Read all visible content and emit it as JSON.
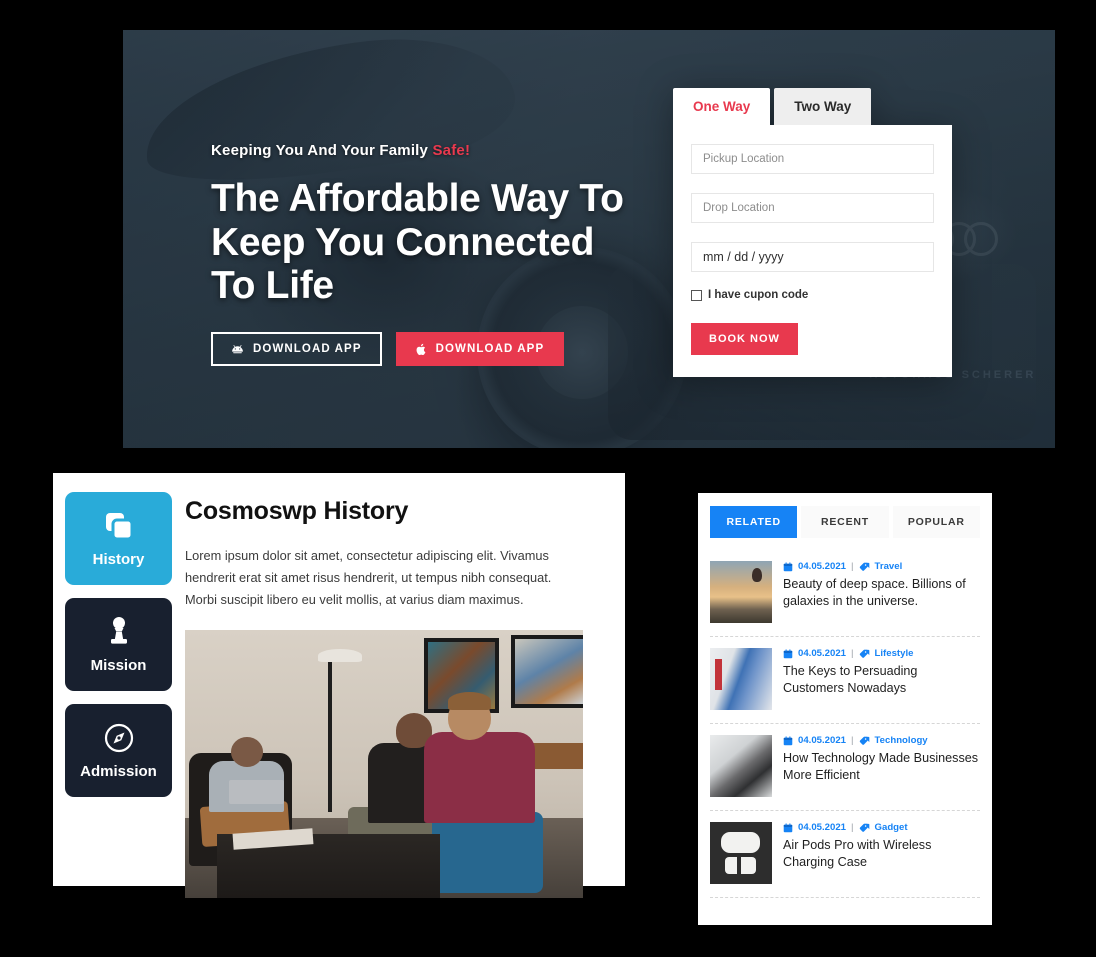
{
  "hero": {
    "kicker_plain": "Keeping You And Your Family ",
    "kicker_accent": "Safe!",
    "title": "The Affordable Way To Keep You Connected To Life",
    "sign_text": "AUTOHAUS SCHERER",
    "buttons": [
      {
        "label": "DOWNLOAD APP",
        "icon": "android-icon",
        "style": "outline"
      },
      {
        "label": "DOWNLOAD APP",
        "icon": "apple-icon",
        "style": "red"
      }
    ],
    "accent_color": "#e8394e"
  },
  "booking": {
    "tabs": [
      {
        "label": "One Way",
        "active": true
      },
      {
        "label": "Two Way",
        "active": false
      }
    ],
    "pickup_placeholder": "Pickup Location",
    "drop_placeholder": "Drop Location",
    "date_value": "mm / dd / yyyy",
    "coupon_label": "I have cupon code",
    "coupon_checked": false,
    "submit_label": "BOOK NOW",
    "active_tab_color": "#e8394e",
    "submit_color": "#e8394e"
  },
  "history": {
    "tabs": [
      {
        "label": "History",
        "icon": "copy-layers-icon",
        "active": true
      },
      {
        "label": "Mission",
        "icon": "chess-pawn-icon",
        "active": false
      },
      {
        "label": "Admission",
        "icon": "compass-icon",
        "active": false
      }
    ],
    "title": "Cosmoswp History",
    "body": "Lorem ipsum dolor sit amet, consectetur adipiscing elit. Vivamus hendrerit erat sit amet risus hendrerit, ut tempus nibh consequat. Morbi suscipit libero eu velit mollis, at varius diam maximus.",
    "photo_alt": "three men sitting in a lounge with laptop and tablet",
    "active_color": "#29abd9",
    "idle_color": "#18202f"
  },
  "posts": {
    "tabs": [
      {
        "label": "RELATED",
        "active": true
      },
      {
        "label": "RECENT",
        "active": false
      },
      {
        "label": "POPULAR",
        "active": false
      }
    ],
    "active_tab_color": "#1683f5",
    "items": [
      {
        "date": "04.05.2021",
        "separator": "|",
        "category": "Travel",
        "title": "Beauty of deep space. Billions of galaxies in the universe.",
        "thumb": "sunset-balloon-thumb"
      },
      {
        "date": "04.05.2021",
        "separator": "|",
        "category": "Lifestyle",
        "title": "The Keys to Persuading Customers Nowadays",
        "thumb": "woman-office-thumb"
      },
      {
        "date": "04.05.2021",
        "separator": "|",
        "category": "Technology",
        "title": "How Technology Made Businesses More Efficient",
        "thumb": "laptop-tablet-thumb"
      },
      {
        "date": "04.05.2021",
        "separator": "|",
        "category": "Gadget",
        "title": "Air Pods Pro with Wireless Charging Case",
        "thumb": "airpods-thumb"
      }
    ]
  }
}
